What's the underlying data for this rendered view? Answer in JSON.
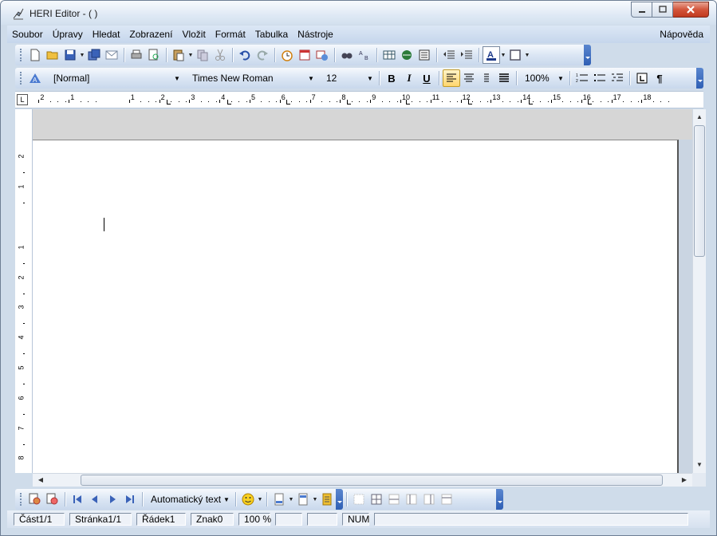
{
  "window": {
    "title": "HERI Editor - ( )"
  },
  "menu": {
    "items": [
      "Soubor",
      "Úpravy",
      "Hledat",
      "Zobrazení",
      "Vložit",
      "Formát",
      "Tabulka",
      "Nástroje"
    ],
    "help": "Nápověda"
  },
  "toolbar": {
    "icons": [
      "new-document-icon",
      "open-folder-icon",
      "save-icon",
      "save-all-icon",
      "email-icon",
      "print-icon",
      "print-preview-icon",
      "paste-icon",
      "copy-icon",
      "cut-icon",
      "undo-icon",
      "redo-icon",
      "clock-icon",
      "calendar-icon",
      "special-chars-icon",
      "find-icon",
      "replace-icon",
      "table-icon",
      "web-icon",
      "page-layout-icon",
      "indent-decrease-icon",
      "indent-increase-icon",
      "font-color-icon",
      "border-icon"
    ]
  },
  "format": {
    "style": "[Normal]",
    "font": "Times New Roman",
    "size": "12",
    "bold": "B",
    "italic": "I",
    "underline": "U",
    "zoom": "100%",
    "pilcrow": "¶"
  },
  "ruler": {
    "numbers": [
      "2",
      "1",
      "1",
      "2",
      "3",
      "4",
      "5",
      "6",
      "7",
      "8",
      "9",
      "10",
      "11",
      "12",
      "13",
      "14",
      "15",
      "16",
      "17",
      "18"
    ]
  },
  "vruler": {
    "numbers": [
      "2",
      "1",
      "1",
      "2",
      "3",
      "4",
      "5",
      "6",
      "7",
      "8"
    ]
  },
  "bottom_toolbar": {
    "autotext": "Automatický text"
  },
  "status": {
    "section": "Část1/1",
    "page": "Stránka1/1",
    "line": "Řádek1",
    "char": "Znak0",
    "zoom": "100 %",
    "num": "NUM"
  },
  "colors": {
    "accent": "#2f5fb5",
    "menubar": "#c6d6ec",
    "close": "#c13a20"
  }
}
